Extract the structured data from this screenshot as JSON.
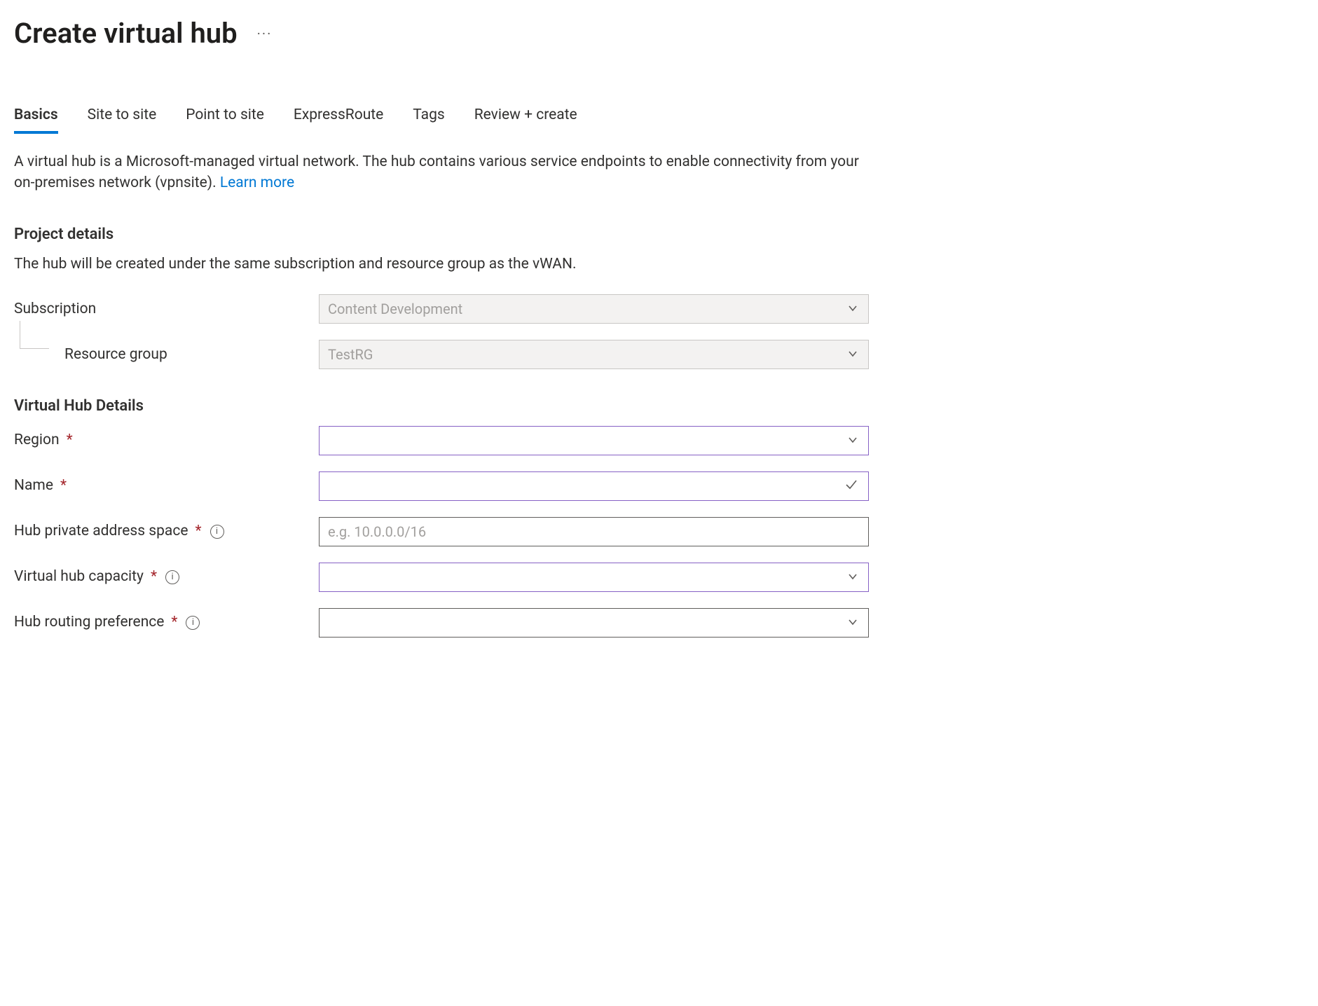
{
  "header": {
    "title": "Create virtual hub"
  },
  "tabs": {
    "basics": "Basics",
    "site_to_site": "Site to site",
    "point_to_site": "Point to site",
    "express_route": "ExpressRoute",
    "tags": "Tags",
    "review_create": "Review + create"
  },
  "description": {
    "text": "A virtual hub is a Microsoft-managed virtual network. The hub contains various service endpoints to enable connectivity from your on-premises network (vpnsite).  ",
    "learn_more": "Learn more"
  },
  "project_details": {
    "heading": "Project details",
    "subtext": "The hub will be created under the same subscription and resource group as the vWAN.",
    "subscription_label": "Subscription",
    "subscription_value": "Content Development",
    "resource_group_label": "Resource group",
    "resource_group_value": "TestRG"
  },
  "vhub_details": {
    "heading": "Virtual Hub Details",
    "region_label": "Region",
    "region_value": "",
    "name_label": "Name",
    "name_value": "",
    "address_space_label": "Hub private address space",
    "address_space_placeholder": "e.g. 10.0.0.0/16",
    "address_space_value": "",
    "capacity_label": "Virtual hub capacity",
    "capacity_value": "",
    "routing_pref_label": "Hub routing preference",
    "routing_pref_value": ""
  }
}
